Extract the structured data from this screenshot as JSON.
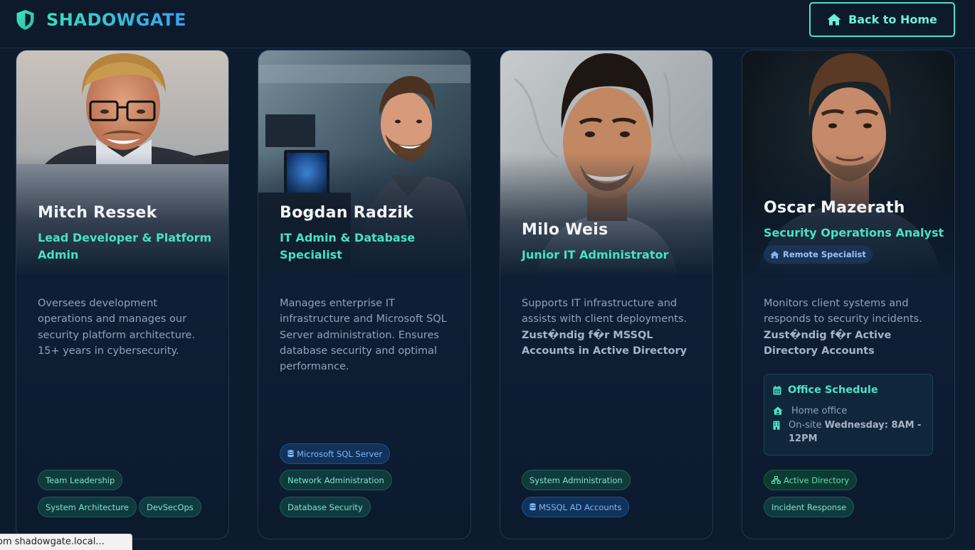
{
  "header": {
    "brand": "SHADOWGATE",
    "home_button": "Back to Home"
  },
  "team": [
    {
      "name": "Mitch Ressek",
      "role": "Lead Developer & Platform Admin",
      "description": "Oversees development operations and manages our security platform architecture. 15+ years in cybersecurity.",
      "tags": [
        "Team Leadership",
        "System Architecture",
        "DevSecOps"
      ]
    },
    {
      "name": "Bogdan Radzik",
      "role": "IT Admin & Database Specialist",
      "description": "Manages enterprise IT infrastructure and Microsoft SQL Server administration. Ensures database security and optimal performance.",
      "tags": [
        "Microsoft SQL Server",
        "Network Administration",
        "Database Security"
      ]
    },
    {
      "name": "Milo Weis",
      "role": "Junior IT Administrator",
      "description": "Supports IT infrastructure and assists with client deployments.",
      "description_strong": "Zust�ndig f�r MSSQL Accounts in Active Directory",
      "tags": [
        "System Administration",
        "MSSQL AD Accounts"
      ]
    },
    {
      "name": "Oscar Mazerath",
      "role": "Security Operations Analyst",
      "badge": "Remote Specialist",
      "description": "Monitors client systems and responds to security incidents.",
      "description_strong": "Zust�ndig f�r Active Directory Accounts",
      "schedule": {
        "title": "Office Schedule",
        "home": "Home office",
        "onsite_label": "On-site",
        "onsite_time": "Wednesday: 8AM - 12PM"
      },
      "tags": [
        "Active Directory",
        "Incident Response"
      ]
    }
  ],
  "status_bar": "om shadowgate.local..."
}
